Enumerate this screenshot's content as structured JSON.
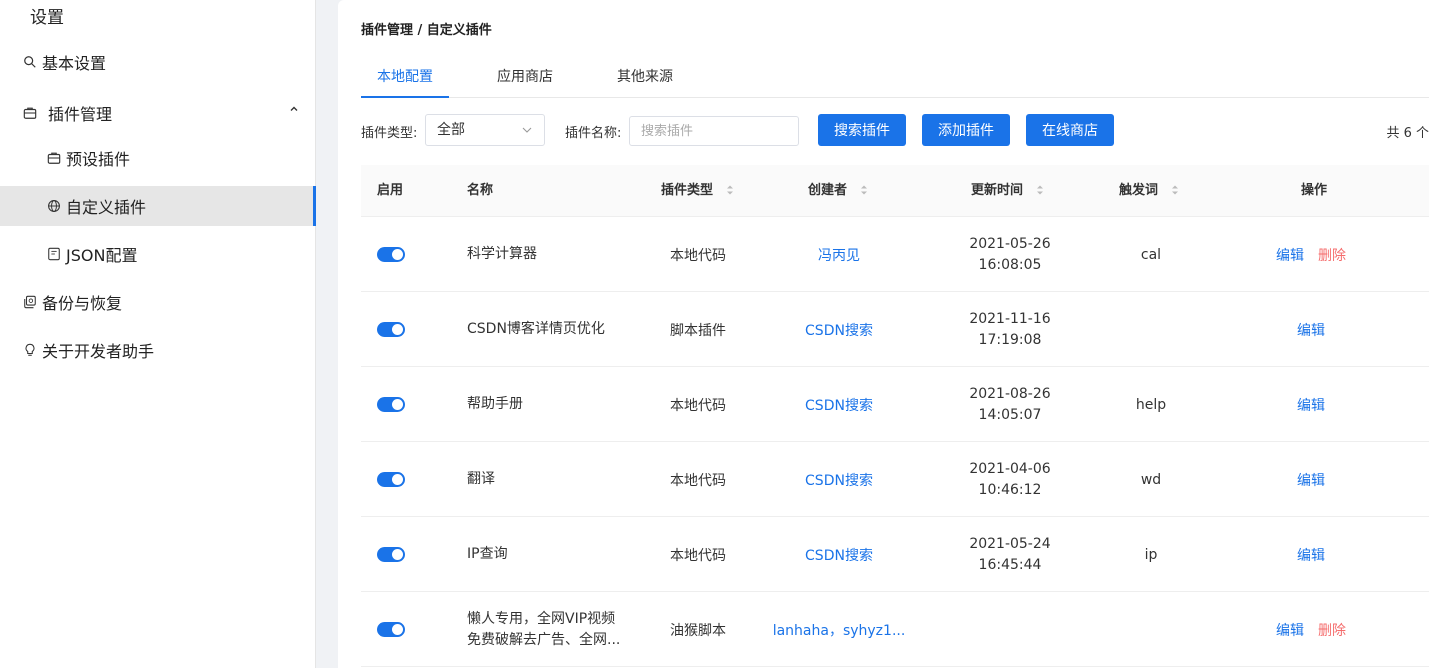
{
  "sidebar": {
    "title": "设置",
    "items": [
      {
        "label": "基本设置",
        "icon": "search-icon"
      },
      {
        "label": "插件管理",
        "icon": "briefcase-icon"
      },
      {
        "label": "预设插件",
        "icon": "briefcase-icon"
      },
      {
        "label": "自定义插件",
        "icon": "globe-icon"
      },
      {
        "label": "JSON配置",
        "icon": "document-icon"
      },
      {
        "label": "备份与恢复",
        "icon": "backup-icon"
      },
      {
        "label": "关于开发者助手",
        "icon": "bulb-icon"
      }
    ],
    "accent_color": "#1a73e8"
  },
  "breadcrumb": "插件管理 / 自定义插件",
  "tabs": [
    {
      "label": "本地配置"
    },
    {
      "label": "应用商店"
    },
    {
      "label": "其他来源"
    }
  ],
  "filters": {
    "type_label": "插件类型:",
    "type_value": "全部",
    "name_label": "插件名称:",
    "name_placeholder": "搜索插件",
    "search_button": "搜索插件",
    "add_button": "添加插件",
    "store_button": "在线商店",
    "total": "共 6 个"
  },
  "table": {
    "headers": {
      "enabled": "启用",
      "name": "名称",
      "type": "插件类型",
      "creator": "创建者",
      "updated": "更新时间",
      "trigger": "触发词",
      "actions": "操作"
    },
    "edit_label": "编辑",
    "delete_label": "删除",
    "rows": [
      {
        "name1": "科学计算器",
        "name2": "",
        "type": "本地代码",
        "creator": "冯丙见",
        "date": "2021-05-26",
        "time": "16:08:05",
        "trigger": "cal",
        "deletable": true
      },
      {
        "name1": "CSDN博客详情页优化",
        "name2": "",
        "type": "脚本插件",
        "creator": "CSDN搜索",
        "date": "2021-11-16",
        "time": "17:19:08",
        "trigger": "",
        "deletable": false
      },
      {
        "name1": "帮助手册",
        "name2": "",
        "type": "本地代码",
        "creator": "CSDN搜索",
        "date": "2021-08-26",
        "time": "14:05:07",
        "trigger": "help",
        "deletable": false
      },
      {
        "name1": "翻译",
        "name2": "",
        "type": "本地代码",
        "creator": "CSDN搜索",
        "date": "2021-04-06",
        "time": "10:46:12",
        "trigger": "wd",
        "deletable": false
      },
      {
        "name1": "IP查询",
        "name2": "",
        "type": "本地代码",
        "creator": "CSDN搜索",
        "date": "2021-05-24",
        "time": "16:45:44",
        "trigger": "ip",
        "deletable": false
      },
      {
        "name1": "懒人专用，全网VIP视频",
        "name2": "免费破解去广告、全网...",
        "type": "油猴脚本",
        "creator": "lanhaha，syhyz1...",
        "date": "",
        "time": "",
        "trigger": "",
        "deletable": true
      }
    ]
  }
}
